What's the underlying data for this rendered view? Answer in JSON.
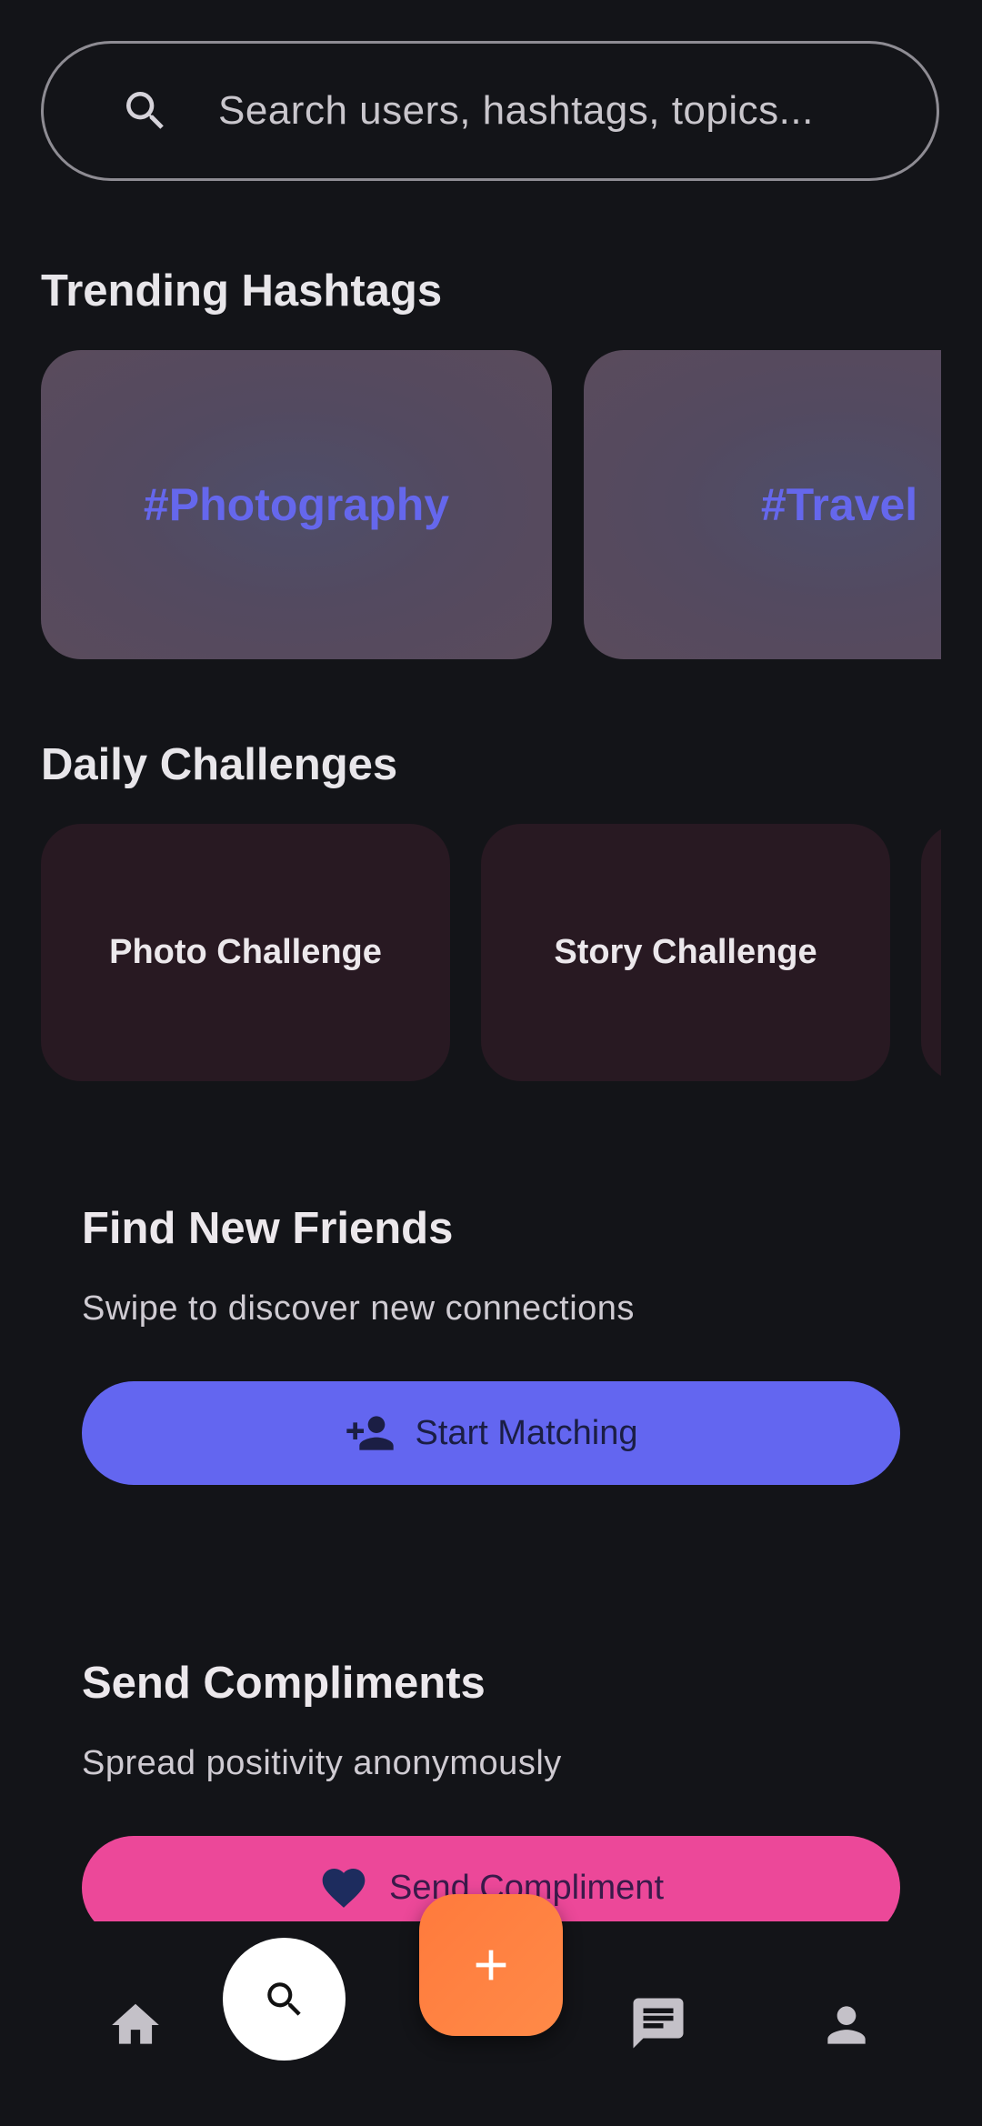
{
  "search": {
    "placeholder": "Search users, hashtags, topics..."
  },
  "trending": {
    "title": "Trending Hashtags",
    "items": [
      {
        "label": "#Photography"
      },
      {
        "label": "#Travel"
      }
    ]
  },
  "challenges": {
    "title": "Daily Challenges",
    "items": [
      {
        "label": "Photo Challenge"
      },
      {
        "label": "Story Challenge"
      },
      {
        "label": ""
      }
    ]
  },
  "find_friends": {
    "title": "Find New Friends",
    "subtitle": "Swipe to discover new connections",
    "button_label": "Start Matching",
    "button_icon": "person-add-icon"
  },
  "compliments": {
    "title": "Send Compliments",
    "subtitle": "Spread positivity anonymously",
    "button_label": "Send Compliment",
    "button_icon": "heart-icon"
  },
  "nav": {
    "items": [
      "home-icon",
      "search-icon",
      "add-icon",
      "chat-icon",
      "profile-icon"
    ],
    "active": "search"
  },
  "colors": {
    "background": "#131418",
    "accent_indigo": "#6366f0",
    "accent_pink": "#ec4899",
    "fab_orange": "#ff7a3c",
    "hashtag_text": "#6567ec",
    "challenge_card": "#281922"
  }
}
